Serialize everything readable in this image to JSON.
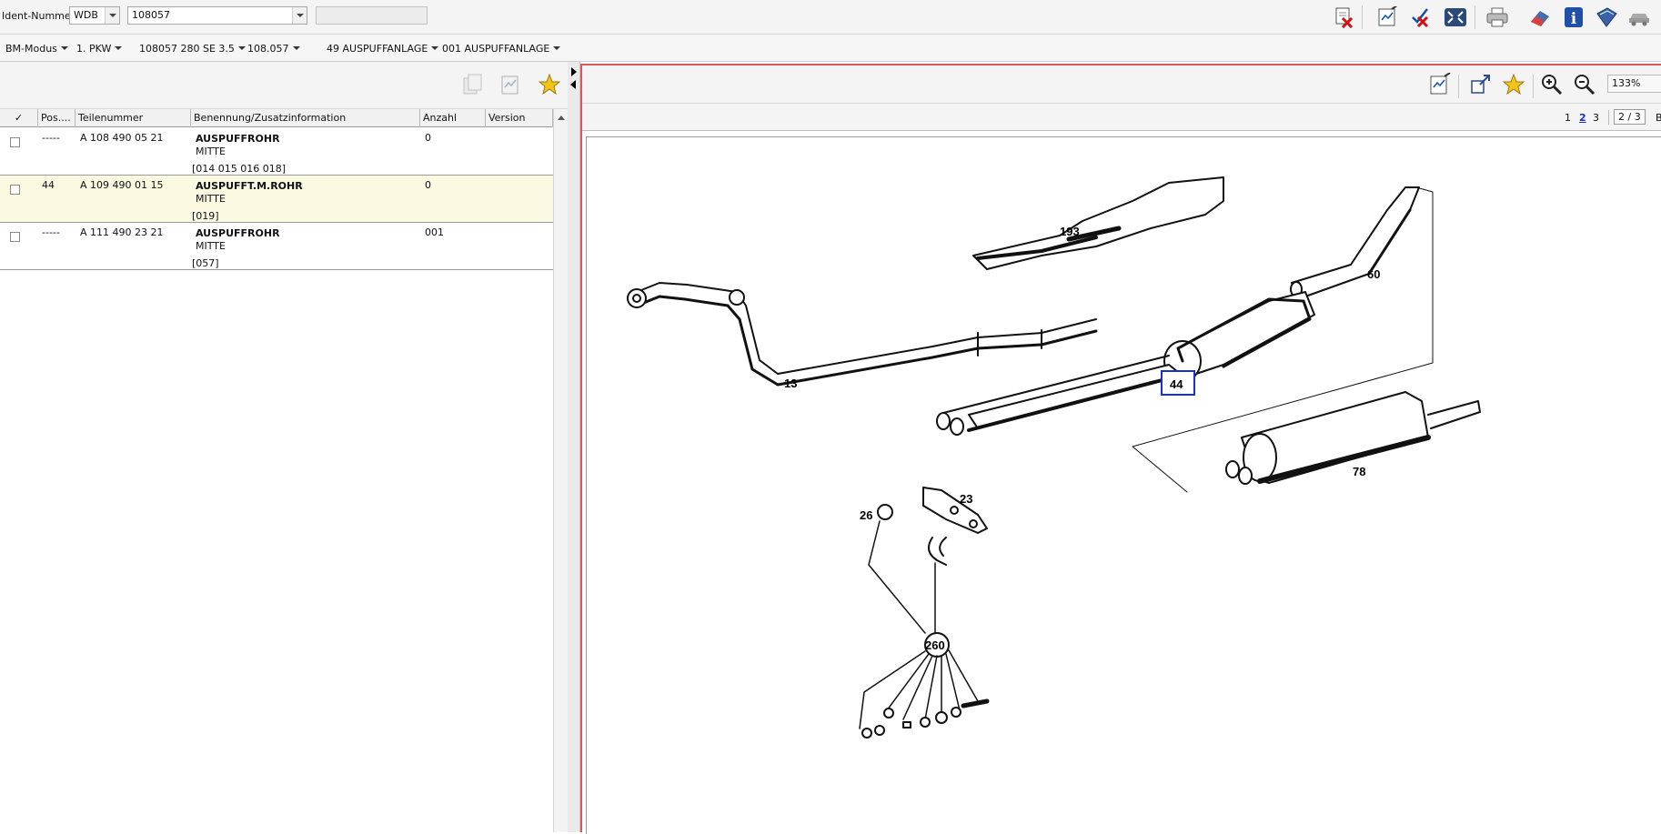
{
  "header": {
    "ident_label": "Ident-Nummer",
    "ident_prefix": "WDB",
    "ident_number": "108057",
    "ident_extra": ""
  },
  "toolbar_icons": [
    "delete-document-icon",
    "notes-icon",
    "check-off-icon",
    "fullscreen-icon",
    "print-icon",
    "eraser-icon",
    "info-icon",
    "manual-book-icon",
    "car-icon"
  ],
  "breadcrumb": [
    "BM-Modus",
    "1. PKW",
    "108057 280 SE 3.5",
    "108.057",
    "49 AUSPUFFANLAGE",
    "001 AUSPUFFANLAGE"
  ],
  "parts_table": {
    "columns": [
      "✓",
      "Pos....",
      "Teilenummer",
      "Benennung/Zusatzinformation",
      "Anzahl",
      "Version"
    ],
    "rows": [
      {
        "pos": "-----",
        "part_no": "A 108 490 05 21",
        "name": "AUSPUFFROHR",
        "info": "MITTE",
        "codes": "[014 015 016 018]",
        "qty": "0",
        "version": ""
      },
      {
        "pos": "44",
        "part_no": "A 109 490 01 15",
        "name": "AUSPUFFT.M.ROHR",
        "info": "MITTE",
        "codes": "[019]",
        "qty": "0",
        "version": ""
      },
      {
        "pos": "-----",
        "part_no": "A 111 490 23 21",
        "name": "AUSPUFFROHR",
        "info": "MITTE",
        "codes": "[057]",
        "qty": "001",
        "version": ""
      }
    ]
  },
  "viewer": {
    "zoom": "133%",
    "pages": [
      "1",
      "2",
      "3"
    ],
    "current_page": "2",
    "page_indicator": "2 / 3",
    "page_more": "B",
    "callouts": [
      "193",
      "60",
      "13",
      "44",
      "78",
      "26",
      "23",
      "260"
    ],
    "highlighted_callout": "44"
  },
  "colors": {
    "selected_row": "#fbf9e1",
    "frame_border": "#d65a5a",
    "highlight_box": "#1a2fd6"
  }
}
